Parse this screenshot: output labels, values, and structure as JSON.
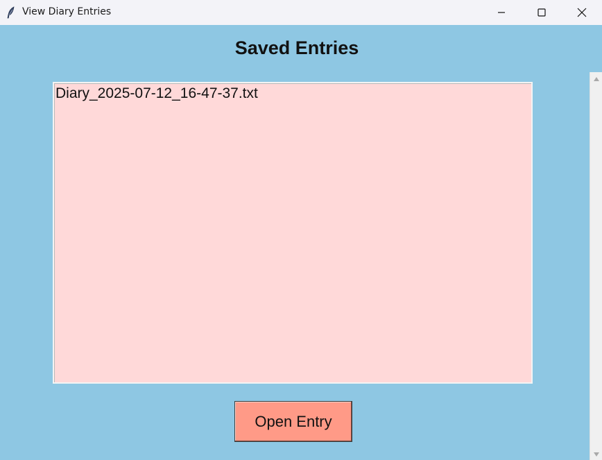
{
  "window": {
    "title": "View Diary Entries",
    "icon": "feather-icon"
  },
  "controls": {
    "minimize": "minimize-icon",
    "maximize": "maximize-icon",
    "close": "close-icon"
  },
  "main": {
    "heading": "Saved Entries",
    "entries": [
      "Diary_2025-07-12_16-47-37.txt"
    ],
    "open_button_label": "Open Entry"
  },
  "colors": {
    "background": "#8ec7e3",
    "listbox": "#ffd9d9",
    "button": "#ff9a87"
  }
}
